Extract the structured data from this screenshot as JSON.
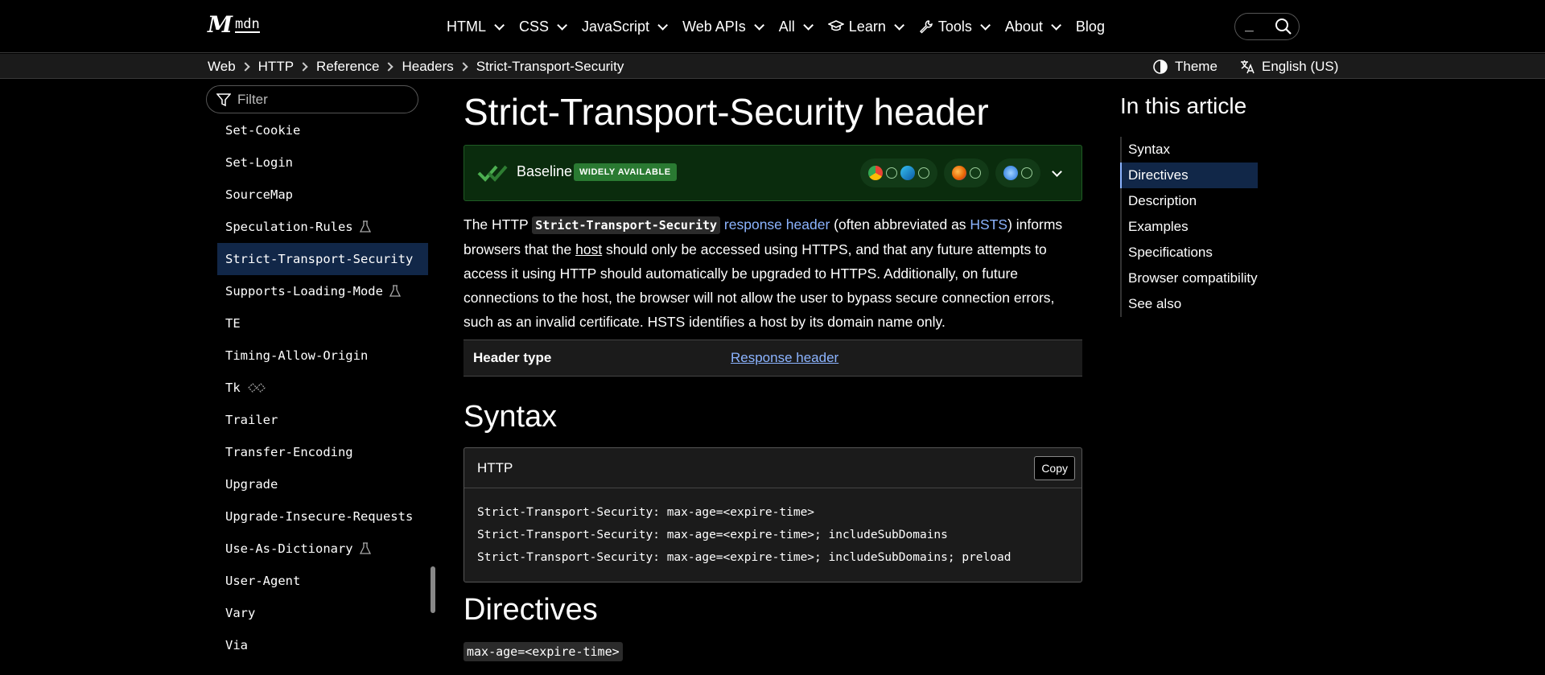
{
  "logo": {
    "mark": "M",
    "text": "mdn"
  },
  "nav": {
    "items": [
      {
        "label": "HTML",
        "chevron": true
      },
      {
        "label": "CSS",
        "chevron": true
      },
      {
        "label": "JavaScript",
        "chevron": true
      },
      {
        "label": "Web APIs",
        "chevron": true
      },
      {
        "label": "All",
        "chevron": true
      },
      {
        "label": "Learn",
        "icon": "graduation-cap-icon",
        "chevron": true
      },
      {
        "label": "Tools",
        "icon": "wrench-icon",
        "chevron": true
      },
      {
        "label": "About",
        "chevron": true
      },
      {
        "label": "Blog",
        "chevron": false
      }
    ],
    "search_cursor": "_"
  },
  "breadcrumb": [
    "Web",
    "HTTP",
    "Reference",
    "Headers",
    "Strict-Transport-Security"
  ],
  "theme_label": "Theme",
  "language_label": "English (US)",
  "sidebar": {
    "filter_placeholder": "Filter",
    "items": [
      {
        "label": "Set-Cookie"
      },
      {
        "label": "Set-Login"
      },
      {
        "label": "SourceMap"
      },
      {
        "label": "Speculation-Rules",
        "badge": "experimental-flask-icon"
      },
      {
        "label": "Strict-Transport-Security",
        "active": true
      },
      {
        "label": "Supports-Loading-Mode",
        "badge": "experimental-flask-icon"
      },
      {
        "label": "TE"
      },
      {
        "label": "Timing-Allow-Origin"
      },
      {
        "label": "Tk",
        "badge": "deprecated-icon"
      },
      {
        "label": "Trailer"
      },
      {
        "label": "Transfer-Encoding"
      },
      {
        "label": "Upgrade"
      },
      {
        "label": "Upgrade-Insecure-Requests"
      },
      {
        "label": "Use-As-Dictionary",
        "badge": "experimental-flask-icon"
      },
      {
        "label": "User-Agent"
      },
      {
        "label": "Vary"
      },
      {
        "label": "Via"
      }
    ]
  },
  "article": {
    "title": "Strict-Transport-Security header",
    "baseline": {
      "label": "Baseline",
      "pill": "WIDELY AVAILABLE"
    },
    "intro": {
      "p1": "The HTTP ",
      "code": "Strict-Transport-Security",
      "link1": "response header",
      "p2": " (often abbreviated as ",
      "link2": "HSTS",
      "p3": ") informs browsers that the ",
      "link3": "host",
      "p4": " should only be accessed using HTTPS, and that any future attempts to access it using HTTP should automatically be upgraded to HTTPS. Additionally, on future connections to the host, the browser will not allow the user to bypass secure connection errors, such as an invalid certificate. HSTS identifies a host by its domain name only."
    },
    "header_type": {
      "label": "Header type",
      "value": "Response header"
    },
    "syntax_heading": "Syntax",
    "code": {
      "lang": "HTTP",
      "copy_label": "Copy",
      "lines": [
        "Strict-Transport-Security: max-age=<expire-time>",
        "Strict-Transport-Security: max-age=<expire-time>; includeSubDomains",
        "Strict-Transport-Security: max-age=<expire-time>; includeSubDomains; preload"
      ]
    },
    "directives_heading": "Directives",
    "directive_term": "max-age=<expire-time>"
  },
  "toc": {
    "heading": "In this article",
    "items": [
      {
        "label": "Syntax"
      },
      {
        "label": "Directives",
        "active": true
      },
      {
        "label": "Description"
      },
      {
        "label": "Examples"
      },
      {
        "label": "Specifications"
      },
      {
        "label": "Browser compatibility"
      },
      {
        "label": "See also"
      }
    ]
  },
  "colors": {
    "link": "#8cb4ff",
    "baseline_bg": "#0a2c0d",
    "active_bg": "#112748"
  }
}
